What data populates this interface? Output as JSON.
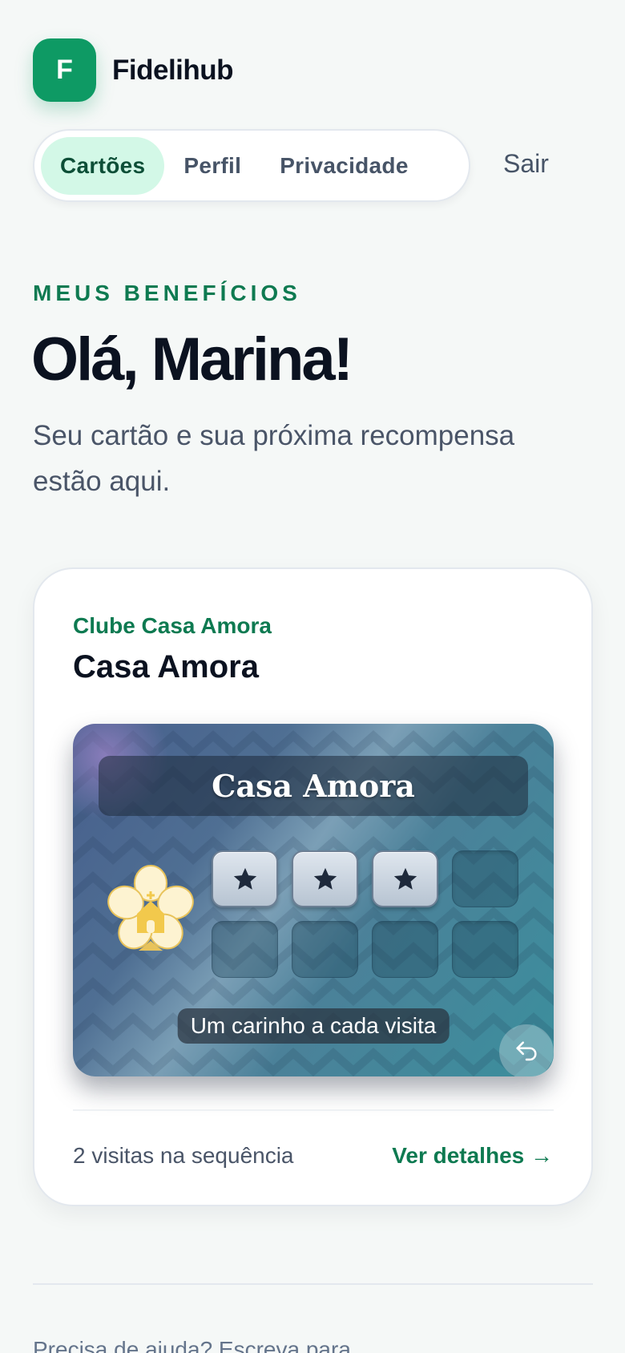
{
  "app": {
    "logo_letter": "F",
    "name": "Fidelihub"
  },
  "nav": {
    "items": [
      {
        "label": "Cartões",
        "active": true
      },
      {
        "label": "Perfil",
        "active": false
      },
      {
        "label": "Privacidade",
        "active": false
      }
    ],
    "logout_label": "Sair"
  },
  "hero": {
    "eyebrow": "MEUS BENEFÍCIOS",
    "greeting": "Olá, Marina!",
    "subtitle": "Seu cartão e sua próxima recompensa estão aqui."
  },
  "loyalty_card": {
    "club_name": "Clube Casa Amora",
    "store_name": "Casa Amora",
    "card_title": "Casa Amora",
    "stamps_total": 8,
    "stamps_filled": 3,
    "tagline": "Um carinho a cada visita",
    "streak_text": "2 visitas na sequência",
    "details_label": "Ver detalhes →",
    "icons": {
      "stamp": "star-icon",
      "emblem": "flower-house-icon",
      "flip": "flip-return-icon"
    }
  },
  "footer": {
    "help_text": "Precisa de ajuda? Escreva para"
  },
  "colors": {
    "brand": "#0e9a64",
    "accent_text": "#0e7a51",
    "active_tab_bg": "#d3f8e7"
  }
}
